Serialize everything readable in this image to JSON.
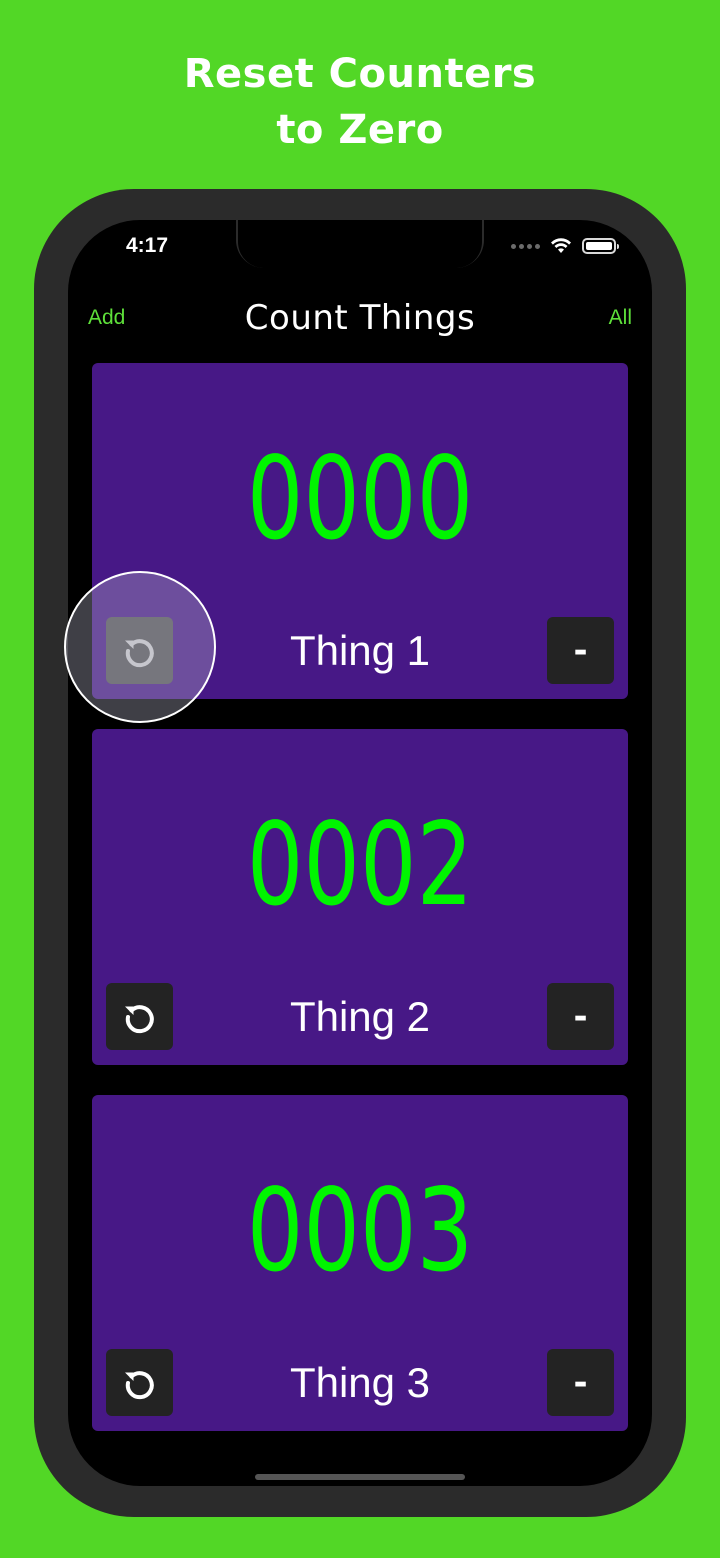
{
  "headline": {
    "line1": "Reset Counters",
    "line2": "to Zero"
  },
  "status_bar": {
    "time": "4:17"
  },
  "navbar": {
    "left_button": "Add",
    "title": "Count Things",
    "right_button": "All"
  },
  "counters": [
    {
      "value": "0000",
      "name": "Thing 1",
      "decrement_label": "-"
    },
    {
      "value": "0002",
      "name": "Thing 2",
      "decrement_label": "-"
    },
    {
      "value": "0003",
      "name": "Thing 3",
      "decrement_label": "-"
    }
  ],
  "colors": {
    "background": "#52d726",
    "card": "#471886",
    "counter_text": "#00f500",
    "nav_button": "#5ee03a"
  },
  "icons": {
    "reset": "reset-icon",
    "wifi": "wifi-icon",
    "battery": "battery-icon"
  }
}
